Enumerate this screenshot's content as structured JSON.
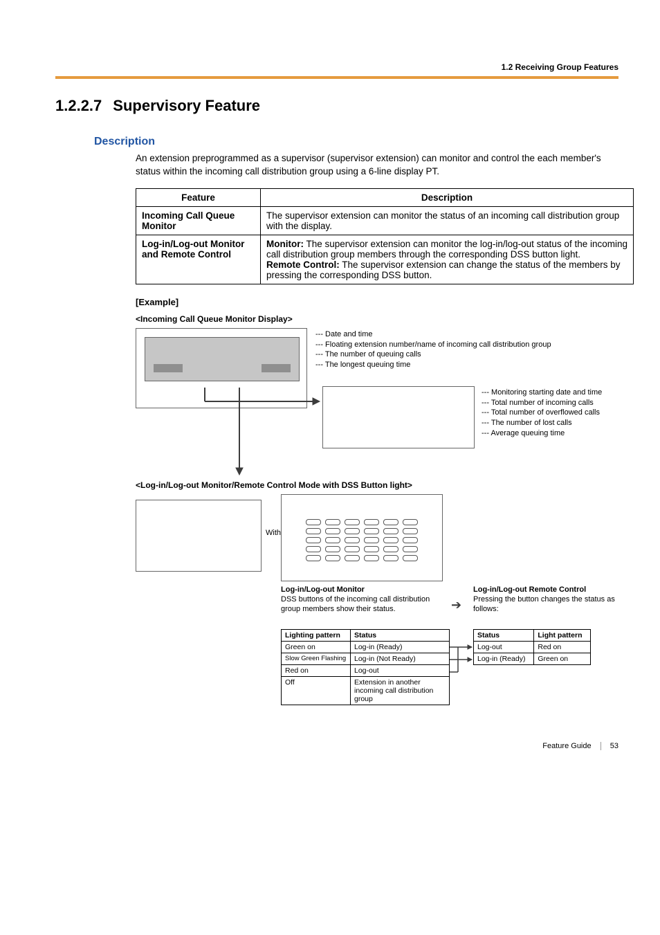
{
  "header": {
    "section_path": "1.2 Receiving Group Features"
  },
  "title": {
    "num": "1.2.2.7",
    "text": "Supervisory Feature"
  },
  "description": {
    "heading": "Description",
    "paragraph": "An extension preprogrammed as a supervisor (supervisor extension) can monitor and control the each member's status within the incoming call distribution group using a 6-line display PT."
  },
  "feature_table": {
    "headers": {
      "feature": "Feature",
      "description": "Description"
    },
    "rows": [
      {
        "feature": "Incoming Call Queue Monitor",
        "desc": "The supervisor extension can monitor the status of an incoming call distribution group with the display."
      },
      {
        "feature": "Log-in/Log-out Monitor and Remote Control",
        "monitor_label": "Monitor:",
        "monitor_text": " The supervisor extension can monitor the log-in/log-out status of the incoming call distribution group members through the corresponding DSS button light.",
        "remote_label": "Remote Control:",
        "remote_text": " The supervisor extension can change the status of the members by pressing the corresponding DSS button."
      }
    ]
  },
  "example_label": "[Example]",
  "diagram1": {
    "title": "<Incoming Call Queue Monitor Display>",
    "left_list": [
      "--- Date and time",
      "--- Floating extension number/name of incoming call distribution group",
      "--- The number of queuing calls",
      "--- The longest queuing time"
    ],
    "right_list": [
      "--- Monitoring starting date and time",
      "--- Total number of incoming calls",
      "--- Total number of overflowed calls",
      "--- The number of lost calls",
      "--- Average queuing time"
    ]
  },
  "diagram2": {
    "title": "<Log-in/Log-out Monitor/Remote Control Mode with DSS Button light>",
    "with_label": "With",
    "monitor": {
      "heading": "Log-in/Log-out Monitor",
      "text": "DSS buttons of the incoming call distribution group members show their status."
    },
    "remote": {
      "heading": "Log-in/Log-out Remote Control",
      "text": "Pressing the button changes the status as follows:"
    },
    "table_left": {
      "headers": {
        "pattern": "Lighting pattern",
        "status": "Status"
      },
      "rows": [
        {
          "pattern": "Green on",
          "status": "Log-in (Ready)"
        },
        {
          "pattern": "Slow Green Flashing",
          "status": "Log-in (Not Ready)"
        },
        {
          "pattern": "Red on",
          "status": "Log-out"
        },
        {
          "pattern": "Off",
          "status": "Extension in another incoming call distribution group"
        }
      ]
    },
    "table_right": {
      "headers": {
        "status": "Status",
        "pattern": "Light pattern"
      },
      "rows": [
        {
          "status": "Log-out",
          "pattern": "Red on"
        },
        {
          "status": "Log-in (Ready)",
          "pattern": "Green on"
        }
      ]
    }
  },
  "footer": {
    "guide": "Feature Guide",
    "page": "53"
  }
}
